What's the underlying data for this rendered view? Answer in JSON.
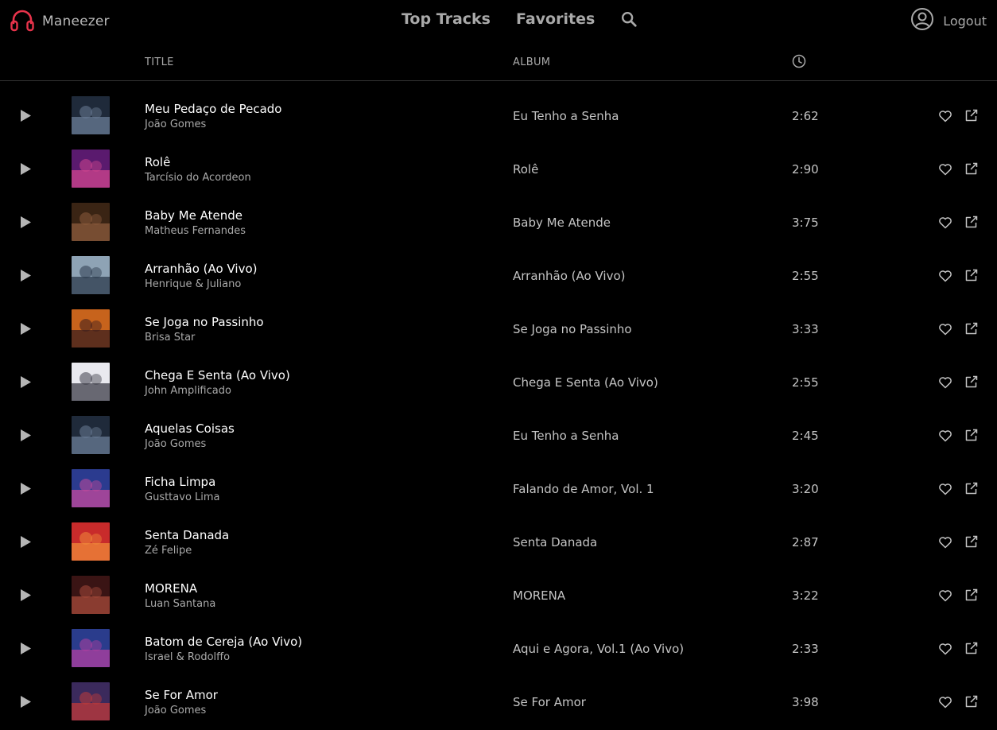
{
  "app": {
    "brand_name": "Maneezer",
    "brand_color": "#e8334b",
    "brand_icon": "headphones-icon"
  },
  "nav": {
    "top_tracks": "Top Tracks",
    "favorites": "Favorites",
    "search_icon": "search-icon"
  },
  "account": {
    "icon": "user-circle-icon",
    "logout": "Logout"
  },
  "table": {
    "headers": {
      "title": "TITLE",
      "album": "ALBUM",
      "duration_icon": "clock-icon"
    },
    "rows": [
      {
        "title": "Meu Pedaço de Pecado",
        "artist": "João Gomes",
        "album": "Eu Tenho a Senha",
        "duration": "2:62",
        "cover_colors": [
          "#1f2a3a",
          "#6a7c95"
        ]
      },
      {
        "title": "Rolê",
        "artist": "Tarcísio do Acordeon",
        "album": "Rolê",
        "duration": "2:90",
        "cover_colors": [
          "#5a1a6e",
          "#d0468f"
        ]
      },
      {
        "title": "Baby Me Atende",
        "artist": "Matheus Fernandes",
        "album": "Baby Me Atende",
        "duration": "3:75",
        "cover_colors": [
          "#3a2414",
          "#8c5b3c"
        ]
      },
      {
        "title": "Arranhão (Ao Vivo)",
        "artist": "Henrique & Juliano",
        "album": "Arranhão (Ao Vivo)",
        "duration": "2:55",
        "cover_colors": [
          "#8ea3b5",
          "#2b3a4c"
        ]
      },
      {
        "title": "Se Joga no Passinho",
        "artist": "Brisa Star",
        "album": "Se Joga no Passinho",
        "duration": "3:33",
        "cover_colors": [
          "#c7631c",
          "#3b1d1d"
        ]
      },
      {
        "title": "Chega E Senta (Ao Vivo)",
        "artist": "John Amplificado",
        "album": "Chega E Senta (Ao Vivo)",
        "duration": "2:55",
        "cover_colors": [
          "#e9e9ef",
          "#3c3c48"
        ]
      },
      {
        "title": "Aquelas Coisas",
        "artist": "João Gomes",
        "album": "Eu Tenho a Senha",
        "duration": "2:45",
        "cover_colors": [
          "#1f2a3a",
          "#6a7c95"
        ]
      },
      {
        "title": "Ficha Limpa",
        "artist": "Gusttavo Lima",
        "album": "Falando de Amor, Vol. 1",
        "duration": "3:20",
        "cover_colors": [
          "#2b3b8f",
          "#c54a9c"
        ]
      },
      {
        "title": "Senta Danada",
        "artist": "Zé Felipe",
        "album": "Senta Danada",
        "duration": "2:87",
        "cover_colors": [
          "#c82b2b",
          "#f08a3a"
        ]
      },
      {
        "title": "MORENA",
        "artist": "Luan Santana",
        "album": "MORENA",
        "duration": "3:22",
        "cover_colors": [
          "#3a1414",
          "#a5493a"
        ]
      },
      {
        "title": "Batom de Cereja (Ao Vivo)",
        "artist": "Israel & Rodolffo",
        "album": "Aqui e Agora, Vol.1 (Ao Vivo)",
        "duration": "2:33",
        "cover_colors": [
          "#2a3c8c",
          "#b23fa0"
        ]
      },
      {
        "title": "Se For Amor",
        "artist": "João Gomes",
        "album": "Se For Amor",
        "duration": "3:98",
        "cover_colors": [
          "#3b2a5c",
          "#c03a3a"
        ]
      }
    ]
  }
}
